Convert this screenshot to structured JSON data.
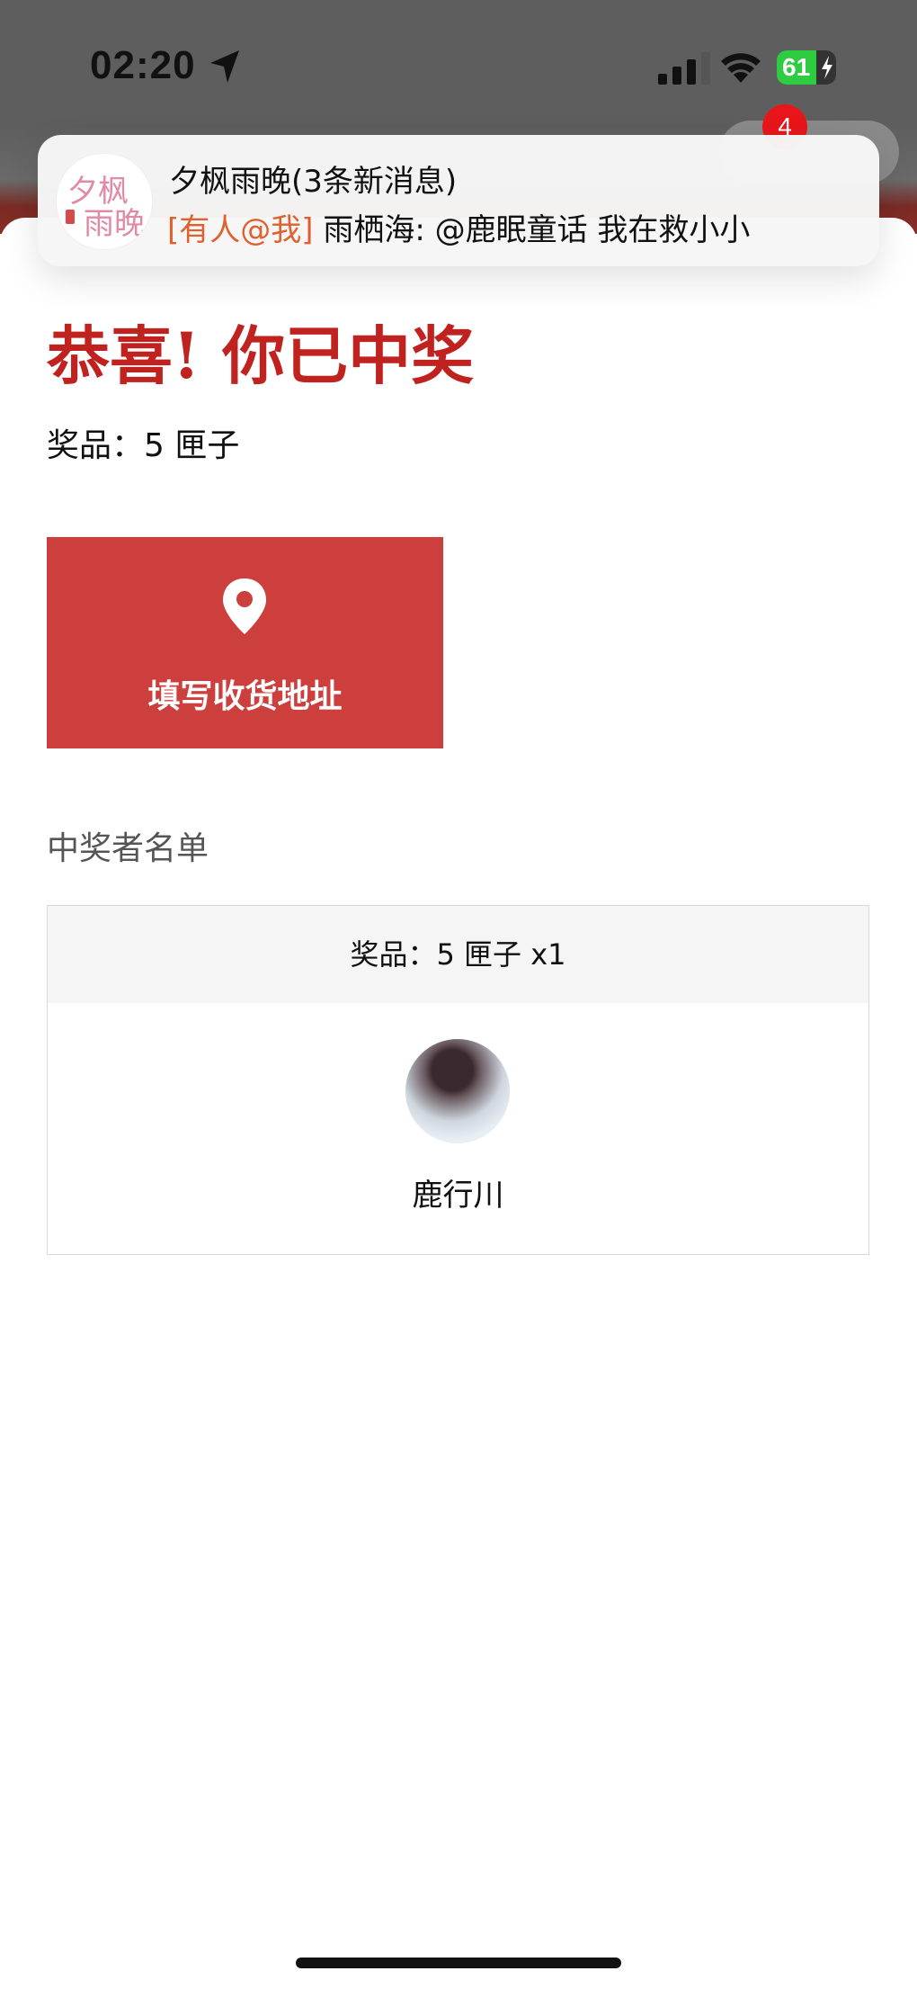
{
  "status_bar": {
    "time": "02:20",
    "battery": "61",
    "icons": [
      "location-arrow-icon",
      "cellular-signal-icon",
      "wifi-icon",
      "battery-charging-icon"
    ]
  },
  "header": {
    "badge_count": "4"
  },
  "notification": {
    "title": "夕枫雨晚(3条新消息)",
    "tag": "[有人@我]",
    "message": " 雨栖海: @鹿眠童话 我在救小小",
    "avatar_line1": "夕枫",
    "avatar_line2": "雨晚"
  },
  "result": {
    "congrats": "恭喜! 你已中奖",
    "prize_line": "奖品：5 匣子",
    "address_button_label": "填写收货地址"
  },
  "winners": {
    "section_title": "中奖者名单",
    "prize_header": "奖品：5 匣子 x1",
    "list": [
      {
        "name": "鹿行川"
      }
    ]
  },
  "colors": {
    "accent_red": "#c0221f",
    "button_red": "#cc3f3c",
    "badge_red": "#e8161b",
    "notif_tag_orange": "#e0602f"
  }
}
